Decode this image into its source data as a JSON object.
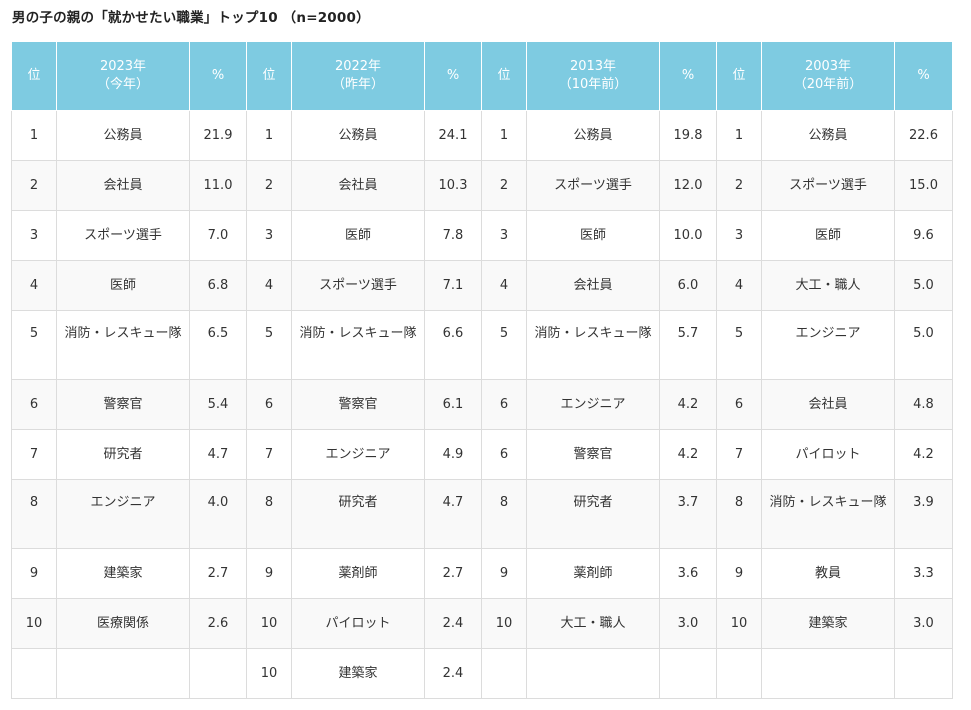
{
  "page": {
    "title": "男の子の親の「就かせたい職業」トップ10 （n=2000）"
  },
  "colors": {
    "header_bg": "#7ecbe1",
    "header_text": "#ffffff",
    "row_alt_bg": "#f9f9f9",
    "border": "#dcdcdc"
  },
  "table": {
    "headers": [
      {
        "rank": "位",
        "year": "2023年",
        "sub": "（今年）",
        "pct": "%"
      },
      {
        "rank": "位",
        "year": "2022年",
        "sub": "（昨年）",
        "pct": "%"
      },
      {
        "rank": "位",
        "year": "2013年",
        "sub": "（10年前）",
        "pct": "%"
      },
      {
        "rank": "位",
        "year": "2003年",
        "sub": "（20年前）",
        "pct": "%"
      }
    ],
    "rows": [
      [
        {
          "rank": "1",
          "job": "公務員",
          "pct": "21.9"
        },
        {
          "rank": "1",
          "job": "公務員",
          "pct": "24.1"
        },
        {
          "rank": "1",
          "job": "公務員",
          "pct": "19.8"
        },
        {
          "rank": "1",
          "job": "公務員",
          "pct": "22.6"
        }
      ],
      [
        {
          "rank": "2",
          "job": "会社員",
          "pct": "11.0"
        },
        {
          "rank": "2",
          "job": "会社員",
          "pct": "10.3"
        },
        {
          "rank": "2",
          "job": "スポーツ選手",
          "pct": "12.0"
        },
        {
          "rank": "2",
          "job": "スポーツ選手",
          "pct": "15.0"
        }
      ],
      [
        {
          "rank": "3",
          "job": "スポーツ選手",
          "pct": "7.0"
        },
        {
          "rank": "3",
          "job": "医師",
          "pct": "7.8"
        },
        {
          "rank": "3",
          "job": "医師",
          "pct": "10.0"
        },
        {
          "rank": "3",
          "job": "医師",
          "pct": "9.6"
        }
      ],
      [
        {
          "rank": "4",
          "job": "医師",
          "pct": "6.8"
        },
        {
          "rank": "4",
          "job": "スポーツ選手",
          "pct": "7.1"
        },
        {
          "rank": "4",
          "job": "会社員",
          "pct": "6.0"
        },
        {
          "rank": "4",
          "job": "大工・職人",
          "pct": "5.0"
        }
      ],
      [
        {
          "rank": "5",
          "job": "消防・レスキュー隊",
          "pct": "6.5"
        },
        {
          "rank": "5",
          "job": "消防・レスキュー隊",
          "pct": "6.6"
        },
        {
          "rank": "5",
          "job": "消防・レスキュー隊",
          "pct": "5.7"
        },
        {
          "rank": "5",
          "job": "エンジニア",
          "pct": "5.0"
        }
      ],
      [
        {
          "rank": "6",
          "job": "警察官",
          "pct": "5.4"
        },
        {
          "rank": "6",
          "job": "警察官",
          "pct": "6.1"
        },
        {
          "rank": "6",
          "job": "エンジニア",
          "pct": "4.2"
        },
        {
          "rank": "6",
          "job": "会社員",
          "pct": "4.8"
        }
      ],
      [
        {
          "rank": "7",
          "job": "研究者",
          "pct": "4.7"
        },
        {
          "rank": "7",
          "job": "エンジニア",
          "pct": "4.9"
        },
        {
          "rank": "6",
          "job": "警察官",
          "pct": "4.2"
        },
        {
          "rank": "7",
          "job": "パイロット",
          "pct": "4.2"
        }
      ],
      [
        {
          "rank": "8",
          "job": "エンジニア",
          "pct": "4.0"
        },
        {
          "rank": "8",
          "job": "研究者",
          "pct": "4.7"
        },
        {
          "rank": "8",
          "job": "研究者",
          "pct": "3.7"
        },
        {
          "rank": "8",
          "job": "消防・レスキュー隊",
          "pct": "3.9"
        }
      ],
      [
        {
          "rank": "9",
          "job": "建築家",
          "pct": "2.7"
        },
        {
          "rank": "9",
          "job": "薬剤師",
          "pct": "2.7"
        },
        {
          "rank": "9",
          "job": "薬剤師",
          "pct": "3.6"
        },
        {
          "rank": "9",
          "job": "教員",
          "pct": "3.3"
        }
      ],
      [
        {
          "rank": "10",
          "job": "医療関係",
          "pct": "2.6"
        },
        {
          "rank": "10",
          "job": "パイロット",
          "pct": "2.4"
        },
        {
          "rank": "10",
          "job": "大工・職人",
          "pct": "3.0"
        },
        {
          "rank": "10",
          "job": "建築家",
          "pct": "3.0"
        }
      ],
      [
        {
          "rank": "",
          "job": "",
          "pct": ""
        },
        {
          "rank": "10",
          "job": "建築家",
          "pct": "2.4"
        },
        {
          "rank": "",
          "job": "",
          "pct": ""
        },
        {
          "rank": "",
          "job": "",
          "pct": ""
        }
      ]
    ]
  }
}
